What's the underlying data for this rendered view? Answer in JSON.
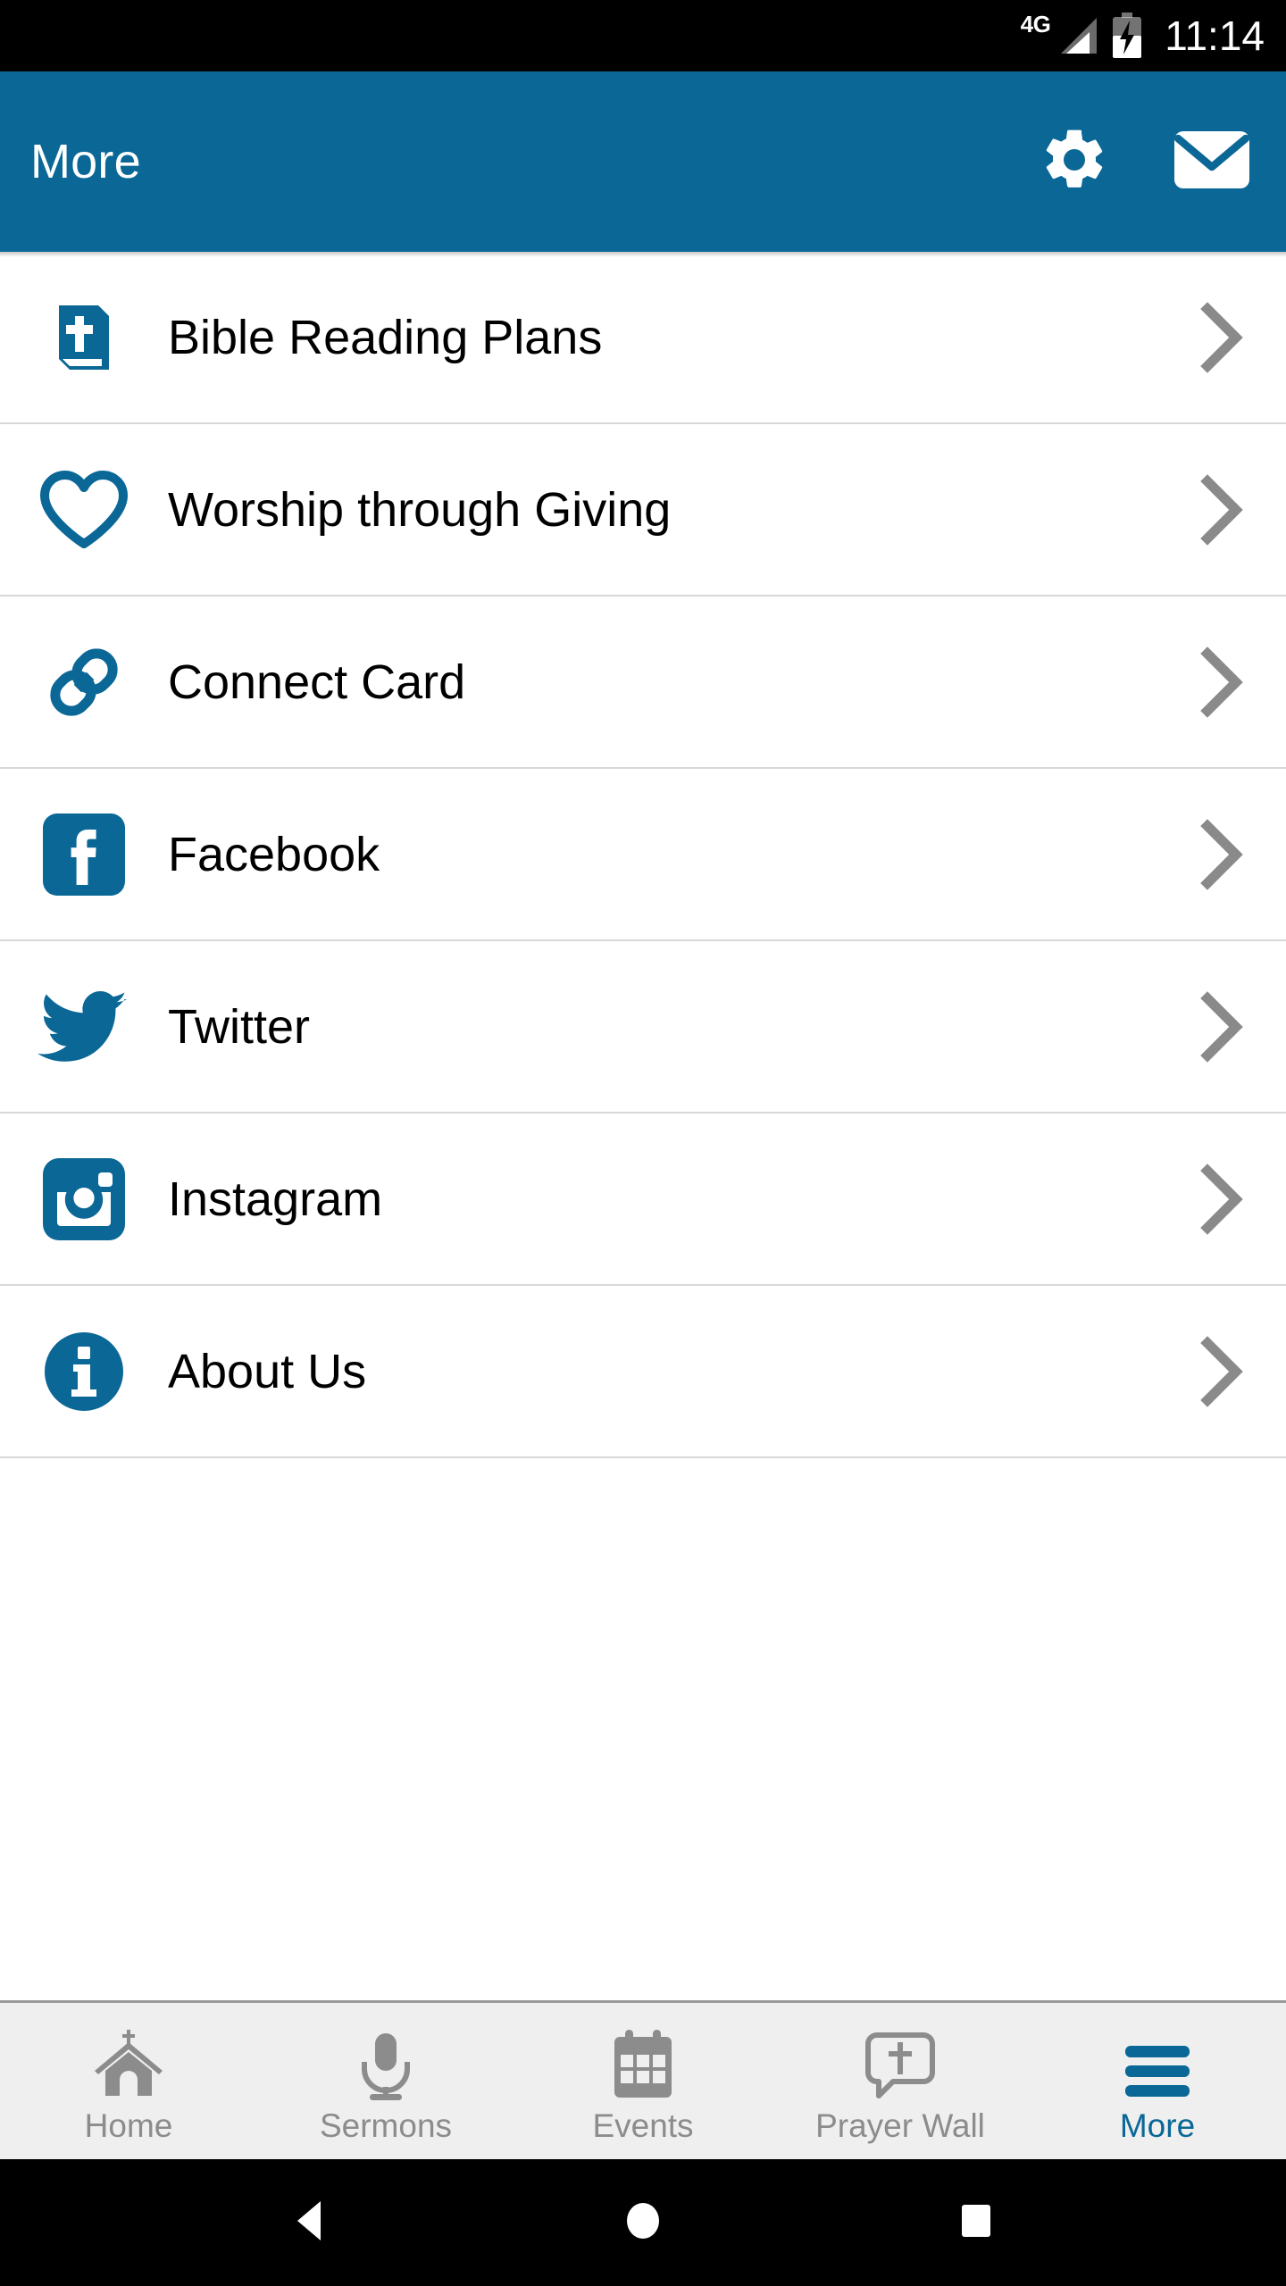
{
  "status_bar": {
    "network": "4G",
    "time": "11:14",
    "battery_icon": "battery-charging-icon",
    "signal_icon": "signal-bars-icon"
  },
  "header": {
    "title": "More",
    "background_color": "#0a6796",
    "text_color": "#ffffff",
    "actions": [
      {
        "name": "settings-button",
        "icon": "gear-icon"
      },
      {
        "name": "mail-button",
        "icon": "envelope-icon"
      }
    ]
  },
  "menu": {
    "items": [
      {
        "label": "Bible Reading Plans",
        "icon": "bible-book-icon",
        "chevron": "chevron-right-icon"
      },
      {
        "label": "Worship through Giving",
        "icon": "heart-outline-icon",
        "chevron": "chevron-right-icon"
      },
      {
        "label": "Connect Card",
        "icon": "chain-link-icon",
        "chevron": "chevron-right-icon"
      },
      {
        "label": "Facebook",
        "icon": "facebook-icon",
        "chevron": "chevron-right-icon"
      },
      {
        "label": "Twitter",
        "icon": "twitter-bird-icon",
        "chevron": "chevron-right-icon"
      },
      {
        "label": "Instagram",
        "icon": "instagram-camera-icon",
        "chevron": "chevron-right-icon"
      },
      {
        "label": "About Us",
        "icon": "info-circle-icon",
        "chevron": "chevron-right-icon"
      }
    ]
  },
  "tab_bar": {
    "active_color": "#0a6796",
    "inactive_color": "#8c8c8c",
    "tabs": [
      {
        "label": "Home",
        "icon": "church-icon",
        "active": false
      },
      {
        "label": "Sermons",
        "icon": "microphone-icon",
        "active": false
      },
      {
        "label": "Events",
        "icon": "calendar-icon",
        "active": false
      },
      {
        "label": "Prayer Wall",
        "icon": "speech-bubble-cross-icon",
        "active": false
      },
      {
        "label": "More",
        "icon": "hamburger-menu-icon",
        "active": true
      }
    ]
  },
  "android_nav": {
    "buttons": [
      {
        "name": "back-button",
        "icon": "triangle-left-icon"
      },
      {
        "name": "home-button",
        "icon": "circle-icon"
      },
      {
        "name": "recents-button",
        "icon": "square-icon"
      }
    ]
  },
  "colors": {
    "brand_blue": "#0a6796",
    "icon_blue": "#0a6796",
    "divider": "#d8d8d8",
    "tabbar_bg": "#efefef",
    "chevron_gray": "#8a8a8a"
  }
}
